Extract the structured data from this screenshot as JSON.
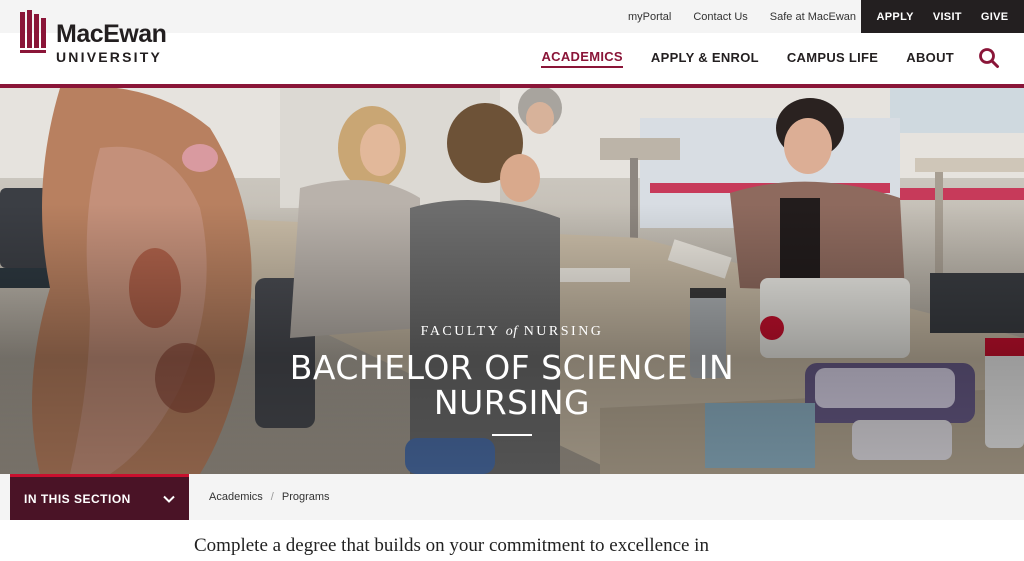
{
  "utility": {
    "links": [
      "myPortal",
      "Contact Us",
      "Safe at MacEwan"
    ],
    "cta": [
      "APPLY",
      "VISIT",
      "GIVE"
    ]
  },
  "logo": {
    "name": "MacEwan",
    "subtitle": "UNIVERSITY"
  },
  "nav": {
    "items": [
      "ACADEMICS",
      "APPLY & ENROL",
      "CAMPUS LIFE",
      "ABOUT"
    ],
    "active": "ACADEMICS"
  },
  "hero": {
    "faculty_prefix": "FACULTY",
    "faculty_of": "of",
    "faculty_suffix": "NURSING",
    "title_line1": "BACHELOR OF SCIENCE IN",
    "title_line2": "NURSING"
  },
  "section": {
    "toggle_label": "IN THIS SECTION",
    "breadcrumb": [
      "Academics",
      "Programs"
    ]
  },
  "intro": {
    "text": "Complete a degree that builds on your commitment to excellence in"
  },
  "colors": {
    "brand": "#8a1538",
    "dark": "#231f20",
    "section_toggle": "#4a1326",
    "section_accent": "#c8102e"
  }
}
